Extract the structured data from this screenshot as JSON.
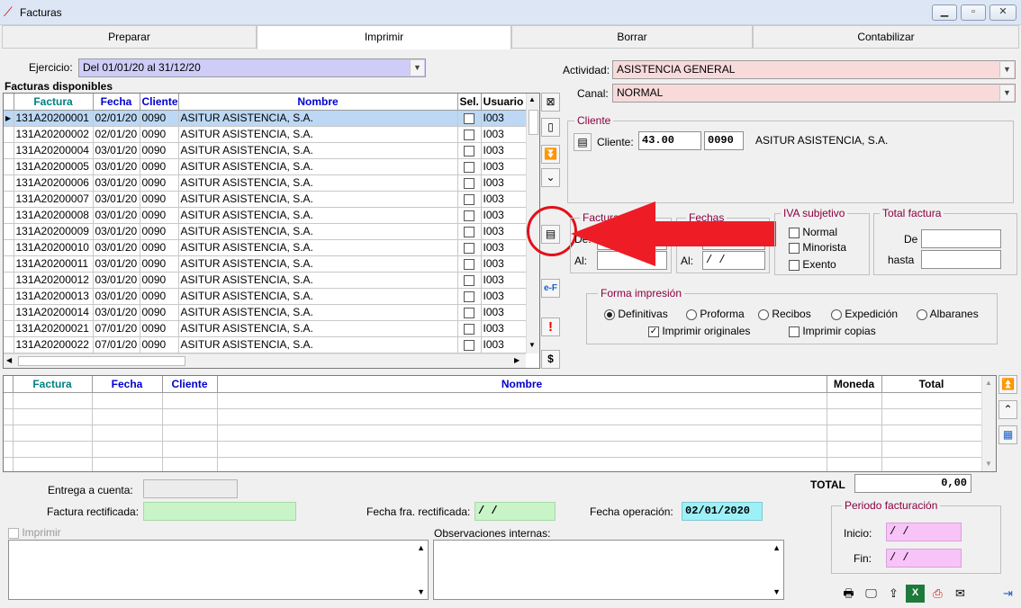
{
  "window": {
    "title": "Facturas"
  },
  "tabs": [
    "Preparar",
    "Imprimir",
    "Borrar",
    "Contabilizar"
  ],
  "ejercicio": {
    "label": "Ejercicio:",
    "value": "Del 01/01/20 al 31/12/20"
  },
  "facturas_disponibles": {
    "title": "Facturas disponibles",
    "columns": [
      "Factura",
      "Fecha",
      "Cliente",
      "Nombre",
      "Sel.",
      "Usuario"
    ],
    "rows": [
      [
        "131A20200001",
        "02/01/20",
        "0090",
        "ASITUR ASISTENCIA, S.A.",
        "I003"
      ],
      [
        "131A20200002",
        "02/01/20",
        "0090",
        "ASITUR ASISTENCIA, S.A.",
        "I003"
      ],
      [
        "131A20200004",
        "03/01/20",
        "0090",
        "ASITUR ASISTENCIA, S.A.",
        "I003"
      ],
      [
        "131A20200005",
        "03/01/20",
        "0090",
        "ASITUR ASISTENCIA, S.A.",
        "I003"
      ],
      [
        "131A20200006",
        "03/01/20",
        "0090",
        "ASITUR ASISTENCIA, S.A.",
        "I003"
      ],
      [
        "131A20200007",
        "03/01/20",
        "0090",
        "ASITUR ASISTENCIA, S.A.",
        "I003"
      ],
      [
        "131A20200008",
        "03/01/20",
        "0090",
        "ASITUR ASISTENCIA, S.A.",
        "I003"
      ],
      [
        "131A20200009",
        "03/01/20",
        "0090",
        "ASITUR ASISTENCIA, S.A.",
        "I003"
      ],
      [
        "131A20200010",
        "03/01/20",
        "0090",
        "ASITUR ASISTENCIA, S.A.",
        "I003"
      ],
      [
        "131A20200011",
        "03/01/20",
        "0090",
        "ASITUR ASISTENCIA, S.A.",
        "I003"
      ],
      [
        "131A20200012",
        "03/01/20",
        "0090",
        "ASITUR ASISTENCIA, S.A.",
        "I003"
      ],
      [
        "131A20200013",
        "03/01/20",
        "0090",
        "ASITUR ASISTENCIA, S.A.",
        "I003"
      ],
      [
        "131A20200014",
        "03/01/20",
        "0090",
        "ASITUR ASISTENCIA, S.A.",
        "I003"
      ],
      [
        "131A20200021",
        "07/01/20",
        "0090",
        "ASITUR ASISTENCIA, S.A.",
        "I003"
      ],
      [
        "131A20200022",
        "07/01/20",
        "0090",
        "ASITUR ASISTENCIA, S.A.",
        "I003"
      ]
    ],
    "selected_row": 0
  },
  "actividad": {
    "label": "Actividad:",
    "value": "ASISTENCIA GENERAL"
  },
  "canal": {
    "label": "Canal:",
    "value": "NORMAL"
  },
  "cliente": {
    "group": "Cliente",
    "label": "Cliente:",
    "code": "43.00",
    "subcode": "0090",
    "name": "ASITUR ASISTENCIA, S.A."
  },
  "facturas_range": {
    "group": "Facturas",
    "de_label": "De:",
    "al_label": "Al:"
  },
  "fechas_range": {
    "group": "Fechas",
    "al_label": "Al:",
    "al_value": " / /"
  },
  "iva_subjetivo": {
    "group": "IVA subjetivo",
    "options": [
      "Normal",
      "Minorista",
      "Exento"
    ]
  },
  "total_factura": {
    "group": "Total factura",
    "de_label": "De",
    "hasta_label": "hasta"
  },
  "forma_impresion": {
    "group": "Forma impresión",
    "options": [
      "Definitivas",
      "Proforma",
      "Recibos",
      "Expedición",
      "Albaranes"
    ],
    "selected": "Definitivas",
    "imprimir_originales": "Imprimir originales",
    "imprimir_copias": "Imprimir copias"
  },
  "lower_grid": {
    "columns": [
      "Factura",
      "Fecha",
      "Cliente",
      "Nombre",
      "Moneda",
      "Total"
    ]
  },
  "total": {
    "label": "TOTAL",
    "value": "0,00"
  },
  "entrega_cuenta": {
    "label": "Entrega a cuenta:"
  },
  "factura_rectificada": {
    "label": "Factura rectificada:"
  },
  "fecha_fra_rectificada": {
    "label": "Fecha fra. rectificada:",
    "value": " /  /"
  },
  "fecha_operacion": {
    "label": "Fecha operación:",
    "value": "02/01/2020"
  },
  "imprimir_check": {
    "label": "Imprimir"
  },
  "observaciones": {
    "label": "Observaciones internas:"
  },
  "periodo": {
    "group": "Periodo facturación",
    "inicio_label": "Inicio:",
    "inicio_value": " / /",
    "fin_label": "Fin:",
    "fin_value": " / /"
  },
  "side_buttons": {
    "euro_f": "e-F",
    "alert": "!",
    "dollar": "$"
  },
  "colors": {
    "highlight_arrow": "#ee1c25",
    "combo_ejercicio": "#cfcdf8",
    "combo_pink": "#f9dada",
    "green_field": "#c8f4c8",
    "cyan_field": "#9ef0f8",
    "pink_field": "#f8c4f8"
  }
}
